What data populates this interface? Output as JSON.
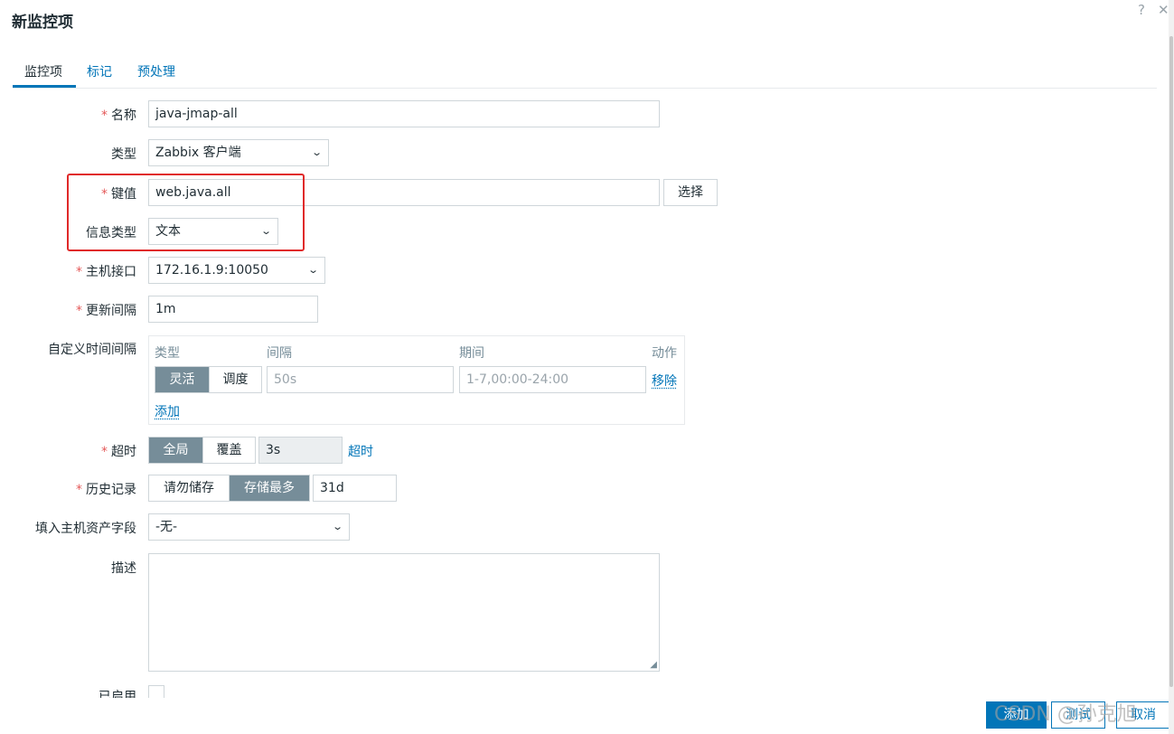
{
  "dialog": {
    "title": "新监控项",
    "help_icon": "?",
    "close_icon": "✕"
  },
  "tabs": [
    {
      "label": "监控项",
      "active": true
    },
    {
      "label": "标记",
      "active": false
    },
    {
      "label": "预处理",
      "active": false
    }
  ],
  "form": {
    "name": {
      "label": "名称",
      "required": true,
      "value": "java-jmap-all"
    },
    "type": {
      "label": "类型",
      "value": "Zabbix 客户端"
    },
    "key": {
      "label": "键值",
      "required": true,
      "value": "web.java.all",
      "select_button": "选择"
    },
    "info_type": {
      "label": "信息类型",
      "value": "文本"
    },
    "host_interface": {
      "label": "主机接口",
      "required": true,
      "value": "172.16.1.9:10050"
    },
    "update_interval": {
      "label": "更新间隔",
      "required": true,
      "value": "1m"
    },
    "custom_intervals": {
      "label": "自定义时间间隔",
      "columns": [
        "类型",
        "间隔",
        "期间",
        "动作"
      ],
      "row": {
        "mode_options": [
          "灵活",
          "调度"
        ],
        "mode_selected": "灵活",
        "interval_placeholder": "50s",
        "period_placeholder": "1-7,00:00-24:00",
        "remove_link": "移除"
      },
      "add_link": "添加"
    },
    "timeout": {
      "label": "超时",
      "required": true,
      "options": [
        "全局",
        "覆盖"
      ],
      "selected": "全局",
      "value": "3s",
      "link": "超时"
    },
    "history": {
      "label": "历史记录",
      "required": true,
      "options": [
        "请勿储存",
        "存储最多"
      ],
      "selected": "存储最多",
      "value": "31d"
    },
    "inventory": {
      "label": "填入主机资产字段",
      "value": "-无-"
    },
    "description": {
      "label": "描述",
      "value": ""
    },
    "enabled": {
      "label": "已启用",
      "checked": true
    }
  },
  "footer": {
    "add_button": "添加",
    "test_button": "测试",
    "cancel_button": "取消"
  },
  "watermark": "CSDN @孙克旭",
  "colors": {
    "link": "#0275b8",
    "required": "#e45959",
    "segment_active": "#768d99",
    "highlight": "#e02a2a"
  }
}
